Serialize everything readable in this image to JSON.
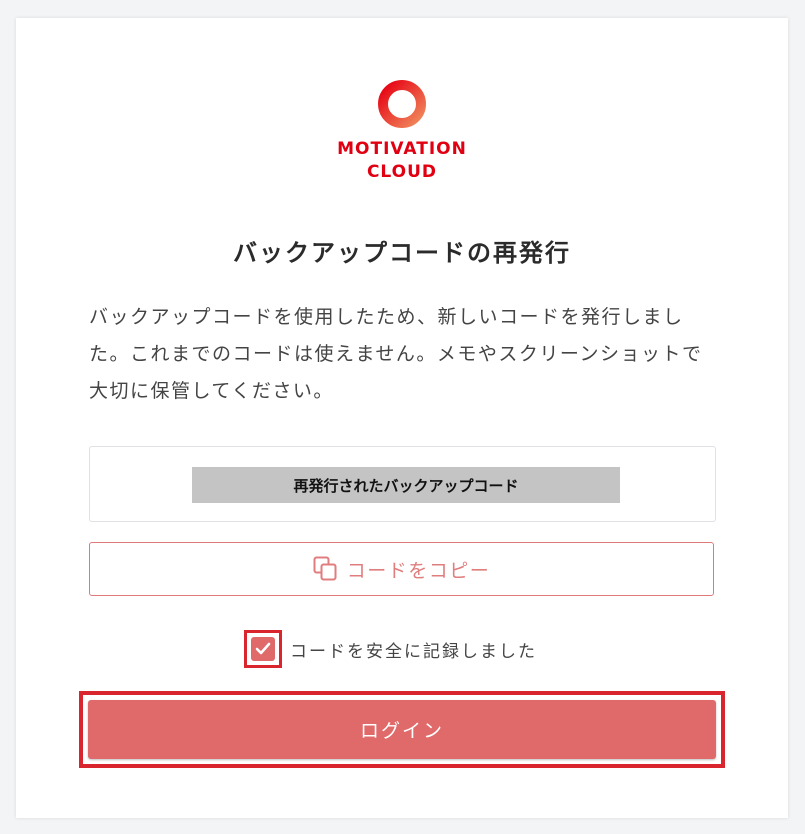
{
  "brand": {
    "logo_icon": "motivation-cloud-ring-logo",
    "line1": "MOTIVATION",
    "line2": "CLOUD",
    "color": "#e10012"
  },
  "page": {
    "title": "バックアップコードの再発行",
    "description": "バックアップコードを使用したため、新しいコードを発行しました。これまでのコードは使えません。メモやスクリーンショットで大切に保管してください。"
  },
  "backup_code": {
    "value": "再発行されたバックアップコード"
  },
  "copy_button": {
    "icon": "copy-icon",
    "label": "コードをコピー"
  },
  "confirm_checkbox": {
    "checked": true,
    "label": "コードを安全に記録しました"
  },
  "login_button": {
    "label": "ログイン"
  },
  "colors": {
    "accent": "#e06a6a",
    "highlight_border": "#d9262e"
  }
}
